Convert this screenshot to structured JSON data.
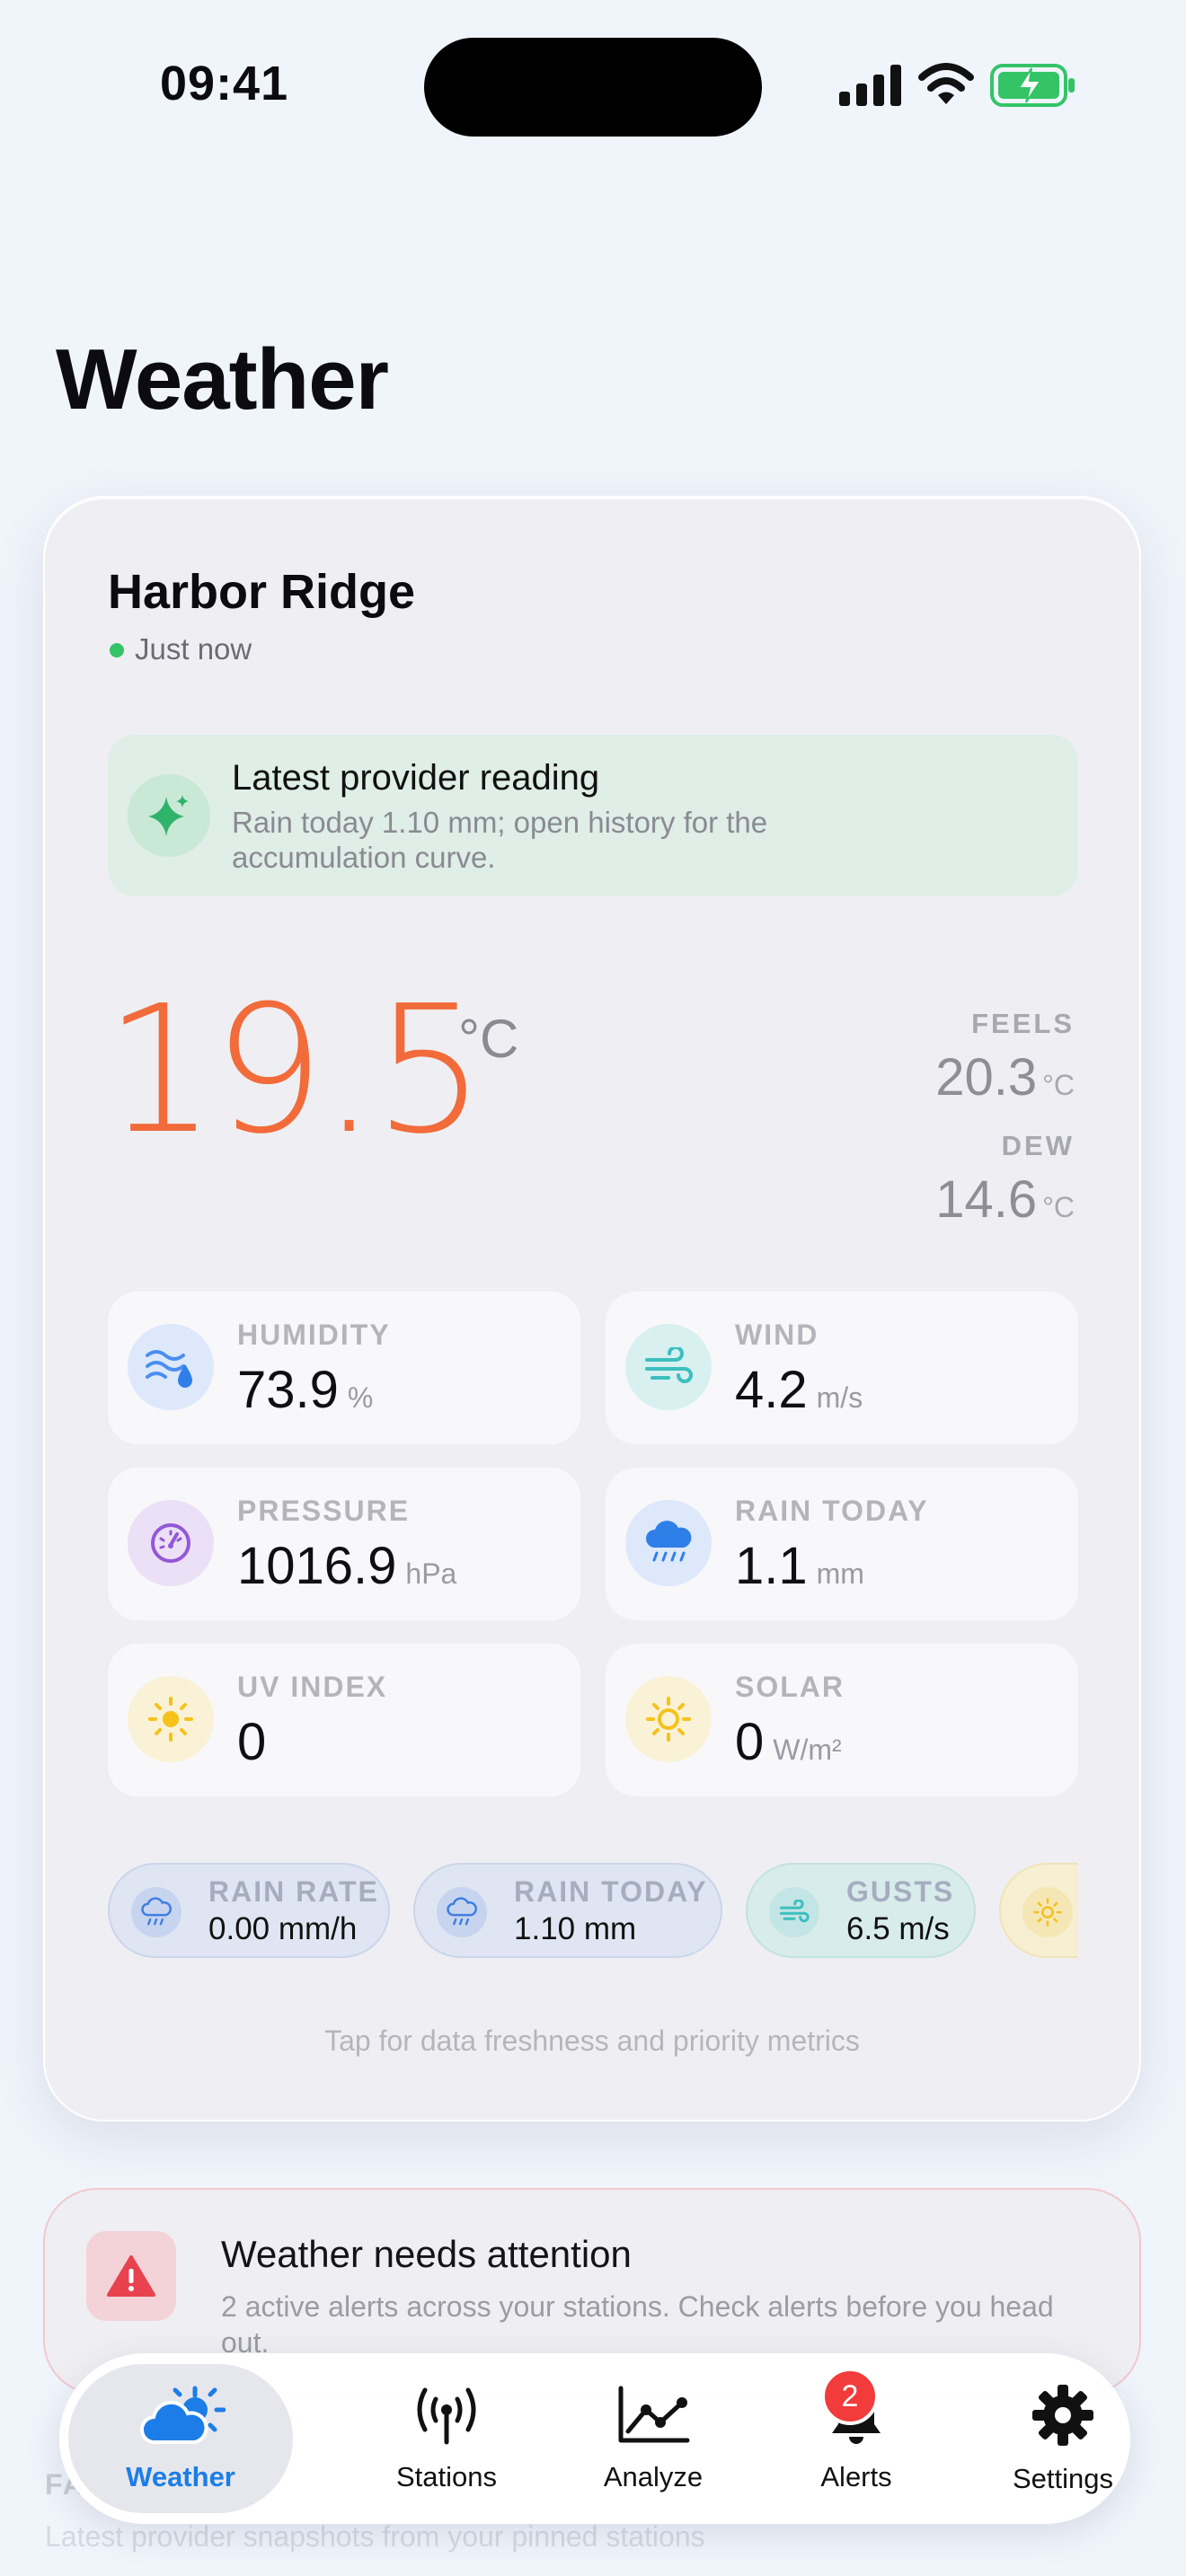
{
  "status_bar": {
    "time": "09:41"
  },
  "page": {
    "title": "Weather"
  },
  "station": {
    "name": "Harbor Ridge",
    "updated": "Just now",
    "status_color": "#34c467"
  },
  "banner": {
    "title": "Latest provider reading",
    "text": "Rain today 1.10 mm; open history for the accumulation curve.",
    "icon": "sparkle-icon"
  },
  "temperature": {
    "value": "19.5",
    "unit": "°C",
    "color": "#f26b3a",
    "feels_label": "FEELS",
    "feels_value": "20.3",
    "feels_unit": "°C",
    "dew_label": "DEW",
    "dew_value": "14.6",
    "dew_unit": "°C"
  },
  "metrics": [
    {
      "label": "HUMIDITY",
      "value": "73.9",
      "unit": "%",
      "icon": "humidity-icon",
      "icon_bg": "#dde8fb"
    },
    {
      "label": "WIND",
      "value": "4.2",
      "unit": "m/s",
      "icon": "wind-icon",
      "icon_bg": "#d8f0f0"
    },
    {
      "label": "PRESSURE",
      "value": "1016.9",
      "unit": "hPa",
      "icon": "gauge-icon",
      "icon_bg": "#ebe0f6"
    },
    {
      "label": "RAIN TODAY",
      "value": "1.1",
      "unit": "mm",
      "icon": "rain-cloud-icon",
      "icon_bg": "#dde8fb"
    },
    {
      "label": "UV INDEX",
      "value": "0",
      "unit": "",
      "icon": "sun-icon",
      "icon_bg": "#faf2d6"
    },
    {
      "label": "SOLAR",
      "value": "0",
      "unit": "W/m²",
      "icon": "sun-icon",
      "icon_bg": "#faf2d6"
    }
  ],
  "chips": [
    {
      "label": "RAIN RATE",
      "value": "0.00 mm/h",
      "icon": "rain-cloud-icon"
    },
    {
      "label": "RAIN TODAY",
      "value": "1.10 mm",
      "icon": "rain-cloud-icon"
    },
    {
      "label": "GUSTS",
      "value": "6.5 m/s",
      "icon": "wind-icon"
    },
    {
      "label": "",
      "value": "",
      "icon": "sun-icon"
    }
  ],
  "card_hint": "Tap for data freshness and priority metrics",
  "alert": {
    "title": "Weather needs attention",
    "text": "2 active alerts across your stations. Check alerts before you head out.",
    "icon": "warning-icon",
    "accent": "#e8424f"
  },
  "faded": {
    "heading": "FA",
    "subtext": "Latest provider snapshots from your pinned stations"
  },
  "tabs": [
    {
      "label": "Weather",
      "icon": "weather-icon",
      "active": true
    },
    {
      "label": "Stations",
      "icon": "antenna-icon",
      "active": false
    },
    {
      "label": "Analyze",
      "icon": "chart-icon",
      "active": false
    },
    {
      "label": "Alerts",
      "icon": "bell-icon",
      "active": false,
      "badge": "2"
    },
    {
      "label": "Settings",
      "icon": "gear-icon",
      "active": false
    }
  ],
  "colors": {
    "accent": "#1c7de8",
    "background": "#f0f4fb"
  }
}
